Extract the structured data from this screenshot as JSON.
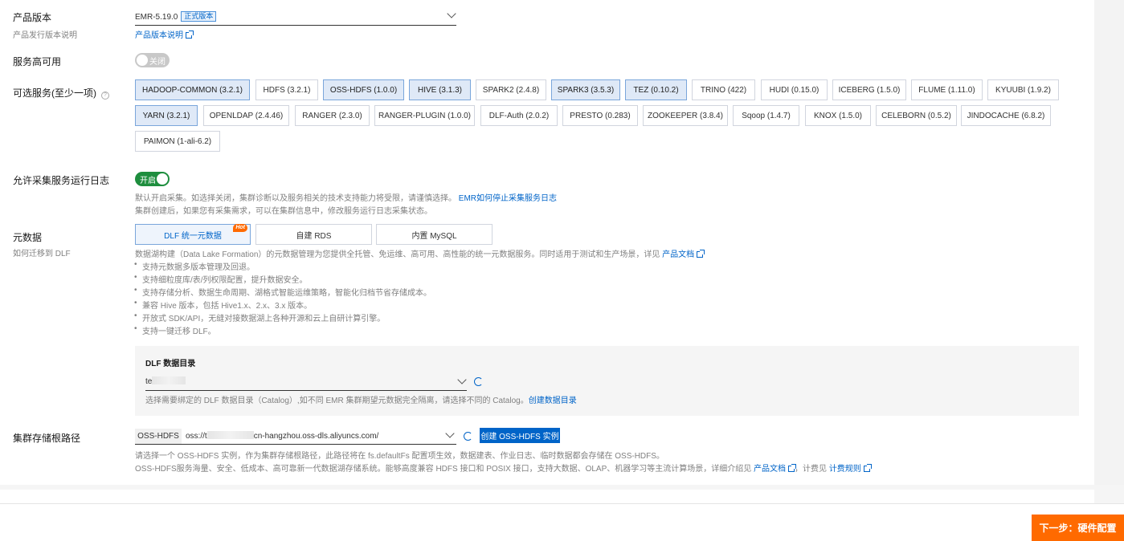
{
  "product_version": {
    "label": "产品版本",
    "sublabel": "产品发行版本说明",
    "value": "EMR-5.19.0",
    "badge": "正式版本",
    "link": "产品版本说明"
  },
  "ha": {
    "label": "服务高可用",
    "toggle_text": "关闭"
  },
  "services": {
    "label": "可选服务(至少一项)",
    "help": "?",
    "items": [
      {
        "label": "HADOOP-COMMON (3.2.1)",
        "selected": true
      },
      {
        "label": "HDFS (3.2.1)",
        "selected": false
      },
      {
        "label": "OSS-HDFS (1.0.0)",
        "selected": true
      },
      {
        "label": "HIVE (3.1.3)",
        "selected": true
      },
      {
        "label": "SPARK2 (2.4.8)",
        "selected": false
      },
      {
        "label": "SPARK3 (3.5.3)",
        "selected": true
      },
      {
        "label": "TEZ (0.10.2)",
        "selected": true
      },
      {
        "label": "TRINO (422)",
        "selected": false
      },
      {
        "label": "HUDI (0.15.0)",
        "selected": false
      },
      {
        "label": "ICEBERG (1.5.0)",
        "selected": false
      },
      {
        "label": "FLUME (1.11.0)",
        "selected": false
      },
      {
        "label": "KYUUBI (1.9.2)",
        "selected": false
      },
      {
        "label": "YARN (3.2.1)",
        "selected": true
      },
      {
        "label": "OPENLDAP (2.4.46)",
        "selected": false
      },
      {
        "label": "RANGER (2.3.0)",
        "selected": false
      },
      {
        "label": "RANGER-PLUGIN (1.0.0)",
        "selected": false
      },
      {
        "label": "DLF-Auth (2.0.2)",
        "selected": false
      },
      {
        "label": "PRESTO (0.283)",
        "selected": false
      },
      {
        "label": "ZOOKEEPER (3.8.4)",
        "selected": false
      },
      {
        "label": "Sqoop (1.4.7)",
        "selected": false
      },
      {
        "label": "KNOX (1.5.0)",
        "selected": false
      },
      {
        "label": "CELEBORN (0.5.2)",
        "selected": false
      },
      {
        "label": "JINDOCACHE (6.8.2)",
        "selected": false
      },
      {
        "label": "PAIMON (1-ali-6.2)",
        "selected": false
      }
    ]
  },
  "log_collect": {
    "label": "允许采集服务运行日志",
    "toggle_text": "开启",
    "desc1": "默认开启采集。如选择关闭，集群诊断以及服务相关的技术支持能力将受限，请谨慎选择。",
    "desc1_link": "EMR如何停止采集服务日志",
    "desc2": "集群创建后，如果您有采集需求，可以在集群信息中，修改服务运行日志采集状态。"
  },
  "metadata": {
    "label": "元数据",
    "sublabel": "如何迁移到 DLF",
    "options": [
      {
        "label": "DLF 统一元数据",
        "selected": true
      },
      {
        "label": "自建 RDS",
        "selected": false
      },
      {
        "label": "内置 MySQL",
        "selected": false
      }
    ],
    "hot": "Hot",
    "desc": "数据湖构建（Data Lake Formation）的元数据管理为您提供全托管、免运维、高可用、高性能的统一元数据服务。同时适用于测试和生产场景，详见",
    "desc_link": "产品文档",
    "bullets": [
      "支持元数据多版本管理及回退。",
      "支持细粒度库/表/列权限配置，提升数据安全。",
      "支持存储分析、数据生命周期、湖格式智能运维策略，智能化归档节省存储成本。",
      "兼容 Hive 版本，包括 Hive1.x、2.x、3.x 版本。",
      "开放式 SDK/API，无缝对接数据湖上各种开源和云上自研计算引擎。",
      "支持一键迁移 DLF。"
    ]
  },
  "dlf_catalog": {
    "title": "DLF 数据目录",
    "value": "te",
    "desc": "选择需要绑定的 DLF 数据目录（Catalog）,如不同 EMR 集群期望元数据完全隔离，请选择不同的 Catalog。",
    "desc_link": "创建数据目录"
  },
  "storage": {
    "label": "集群存储根路径",
    "prefix": "OSS-HDFS",
    "value_start": "oss://t",
    "value_end": "cn-hangzhou.oss-dls.aliyuncs.com/",
    "create_button": "创建 OSS-HDFS 实例",
    "desc1": "请选择一个 OSS-HDFS 实例，作为集群存储根路径，此路径将在 fs.defaultFs 配置项生效，数据建表、作业日志、临时数据都会存储在 OSS-HDFS。",
    "desc2": "OSS-HDFS服务海量、安全、低成本、高可靠新一代数据湖存储系统。能够高度兼容 HDFS 接口和 POSIX 接口，支持大数据、OLAP、机器学习等主流计算场景，详细介绍见",
    "desc2_link1": "产品文档",
    "desc2_mid": "，计费见",
    "desc2_link2": "计费规则"
  },
  "footer": {
    "next_button": "下一步：硬件配置"
  },
  "colors": {
    "accent": "#0064c8",
    "primary_action": "#ff6a00",
    "toggle_on": "#1e8e3e"
  }
}
